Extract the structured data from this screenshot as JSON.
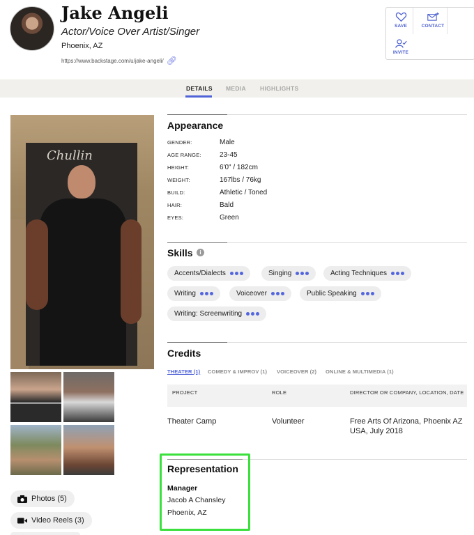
{
  "profile": {
    "name": "Jake Angeli",
    "tagline": "Actor/Voice Over Artist/Singer",
    "location": "Phoenix, AZ",
    "url": "https://www.backstage.com/u/jake-angeli/"
  },
  "actions": {
    "save": "SAVE",
    "contact": "CONTACT",
    "invite": "INVITE"
  },
  "tabs": [
    "DETAILS",
    "MEDIA",
    "HIGHLIGHTS"
  ],
  "photo": {
    "poster_text": "Chullin"
  },
  "appearance": {
    "title": "Appearance",
    "rows": [
      {
        "label": "GENDER:",
        "value": "Male"
      },
      {
        "label": "AGE RANGE:",
        "value": "23-45"
      },
      {
        "label": "HEIGHT:",
        "value": "6'0\" / 182cm"
      },
      {
        "label": "WEIGHT:",
        "value": "167lbs / 76kg"
      },
      {
        "label": "BUILD:",
        "value": "Athletic / Toned"
      },
      {
        "label": "HAIR:",
        "value": "Bald"
      },
      {
        "label": "EYES:",
        "value": "Green"
      }
    ]
  },
  "skills": {
    "title": "Skills",
    "info_icon": "i",
    "items": [
      "Accents/Dialects",
      "Singing",
      "Acting Techniques",
      "Writing",
      "Voiceover",
      "Public Speaking",
      "Writing: Screenwriting"
    ]
  },
  "credits": {
    "title": "Credits",
    "tabs": [
      "THEATER (1)",
      "COMEDY & IMPROV (1)",
      "VOICEOVER (2)",
      "ONLINE & MULTIMEDIA (1)"
    ],
    "columns": [
      "PROJECT",
      "ROLE",
      "DIRECTOR OR COMPANY, LOCATION, DATE"
    ],
    "rows": [
      {
        "project": "Theater Camp",
        "role": "Volunteer",
        "director": "Free Arts Of Arizona, Phoenix AZ USA, July 2018"
      }
    ]
  },
  "representation": {
    "title": "Representation",
    "type": "Manager",
    "name": "Jacob A Chansley",
    "location": "Phoenix, AZ"
  },
  "media_buttons": {
    "photos": "Photos (5)",
    "video_reels": "Video Reels (3)"
  },
  "colors": {
    "accent": "#4f62d8",
    "highlight_box": "#3ce03c",
    "tab_bar": "#f1f0ec"
  }
}
